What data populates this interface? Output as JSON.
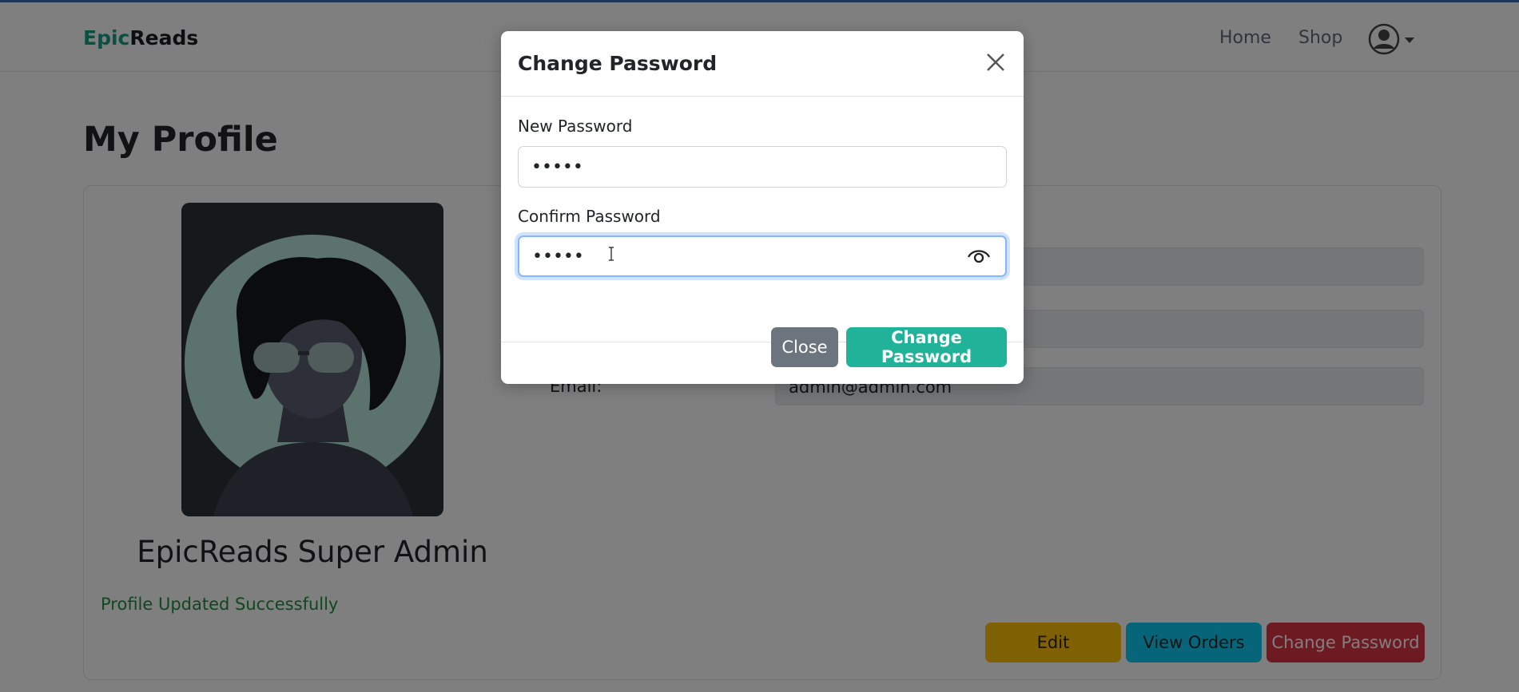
{
  "navbar": {
    "brand_part1": "Epic",
    "brand_part2": "Reads",
    "links": [
      "Home",
      "Shop"
    ]
  },
  "profile": {
    "page_title": "My Profile",
    "admin_name": "EpicReads Super Admin",
    "status_message": "Profile Updated Successfully",
    "fields": [
      {
        "label": "Email:",
        "value": "admin@admin.com"
      }
    ],
    "actions": {
      "edit_label": "Edit",
      "orders_label": "View Orders",
      "change_password_label": "Change Password"
    }
  },
  "modal": {
    "title": "Change Password",
    "new_password_label": "New Password",
    "new_password_value": "•••••",
    "confirm_password_label": "Confirm Password",
    "confirm_password_value": "•••••",
    "close_label": "Close",
    "submit_label": "Change Password"
  },
  "icons": {
    "close": "close-icon",
    "eye": "eye-icon",
    "user": "user-circle-icon",
    "caret": "chevron-down-icon"
  },
  "colors": {
    "accent": "#16a085",
    "submit": "#20b39a",
    "secondary": "#6c757d",
    "edit": "#ffc107",
    "orders": "#0dcaf0",
    "danger": "#dc3545",
    "focus": "#86b7fe"
  }
}
